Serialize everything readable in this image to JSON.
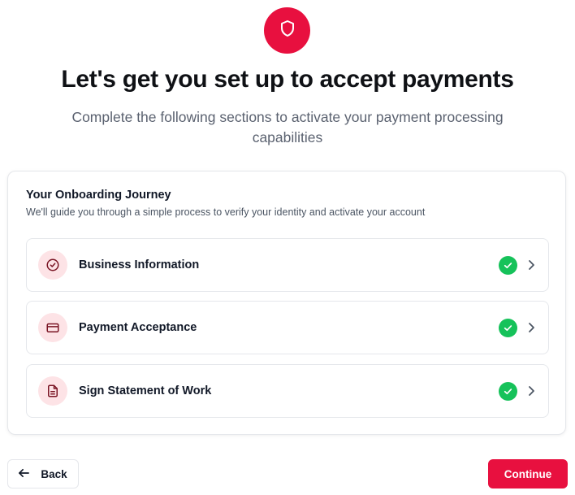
{
  "header": {
    "icon": "shield-icon",
    "title": "Let's get you set up to accept payments",
    "subtitle": "Complete the following sections to activate your payment processing capabilities"
  },
  "journey": {
    "title": "Your Onboarding Journey",
    "description": "We'll guide you through a simple process to verify your identity and activate your account",
    "steps": [
      {
        "label": "Business Information",
        "icon": "check-circle-icon",
        "status": "complete"
      },
      {
        "label": "Payment Acceptance",
        "icon": "credit-card-icon",
        "status": "complete"
      },
      {
        "label": "Sign Statement of Work",
        "icon": "document-icon",
        "status": "complete"
      }
    ]
  },
  "footer": {
    "back_label": "Back",
    "continue_label": "Continue"
  },
  "colors": {
    "accent": "#e8103f",
    "success": "#16c25a",
    "icon_bg": "#fde3e6"
  }
}
